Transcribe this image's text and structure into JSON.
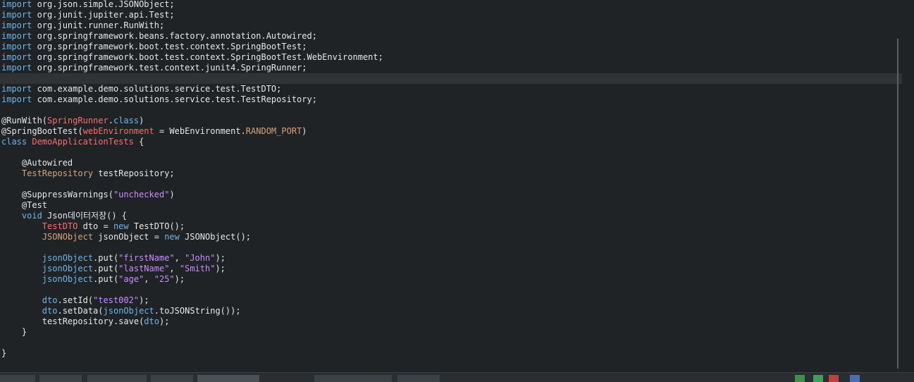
{
  "code": {
    "lines": [
      [
        {
          "t": "import",
          "c": "kw"
        },
        {
          "t": " org.json.simple.JSONObject;",
          "c": "id"
        }
      ],
      [
        {
          "t": "import",
          "c": "kw"
        },
        {
          "t": " org.junit.jupiter.api.Test;",
          "c": "id"
        }
      ],
      [
        {
          "t": "import",
          "c": "kw"
        },
        {
          "t": " org.junit.runner.RunWith;",
          "c": "id"
        }
      ],
      [
        {
          "t": "import",
          "c": "kw"
        },
        {
          "t": " org.springframework.beans.factory.annotation.Autowired;",
          "c": "id"
        }
      ],
      [
        {
          "t": "import",
          "c": "kw"
        },
        {
          "t": " org.springframework.boot.test.context.SpringBootTest;",
          "c": "id"
        }
      ],
      [
        {
          "t": "import",
          "c": "kw"
        },
        {
          "t": " org.springframework.boot.test.context.SpringBootTest.WebEnvironment;",
          "c": "id"
        }
      ],
      [
        {
          "t": "import",
          "c": "kw"
        },
        {
          "t": " org.springframework.test.context.junit4.SpringRunner;",
          "c": "id"
        }
      ],
      [],
      [
        {
          "t": "import",
          "c": "kw"
        },
        {
          "t": " com.example.demo.solutions.service.test.TestDTO;",
          "c": "id"
        }
      ],
      [
        {
          "t": "import",
          "c": "kw"
        },
        {
          "t": " com.example.demo.solutions.service.test.TestRepository;",
          "c": "id"
        }
      ],
      [],
      [
        {
          "t": "@RunWith(",
          "c": "an"
        },
        {
          "t": "SpringRunner",
          "c": "ty"
        },
        {
          "t": ".",
          "c": "id"
        },
        {
          "t": "class",
          "c": "kw"
        },
        {
          "t": ")",
          "c": "id"
        }
      ],
      [
        {
          "t": "@SpringBootTest(",
          "c": "an"
        },
        {
          "t": "webEnvironment",
          "c": "ty"
        },
        {
          "t": " = WebEnvironment.",
          "c": "id"
        },
        {
          "t": "RANDOM_PORT",
          "c": "fld"
        },
        {
          "t": ")",
          "c": "id"
        }
      ],
      [
        {
          "t": "class",
          "c": "kw"
        },
        {
          "t": " ",
          "c": "id"
        },
        {
          "t": "DemoApplicationTests",
          "c": "ty"
        },
        {
          "t": " {",
          "c": "id"
        }
      ],
      [],
      [
        {
          "t": "    @Autowired",
          "c": "an"
        }
      ],
      [
        {
          "t": "    ",
          "c": "id"
        },
        {
          "t": "TestRepository",
          "c": "fld"
        },
        {
          "t": " testRepository;",
          "c": "id"
        }
      ],
      [],
      [
        {
          "t": "    @SuppressWarnings(",
          "c": "an"
        },
        {
          "t": "\"unchecked\"",
          "c": "st"
        },
        {
          "t": ")",
          "c": "id"
        }
      ],
      [
        {
          "t": "    @Test",
          "c": "an"
        }
      ],
      [
        {
          "t": "    ",
          "c": "id"
        },
        {
          "t": "void",
          "c": "kw"
        },
        {
          "t": " Json데이터저장() {",
          "c": "id"
        }
      ],
      [
        {
          "t": "        ",
          "c": "id"
        },
        {
          "t": "TestDTO",
          "c": "ty"
        },
        {
          "t": " dto = ",
          "c": "id"
        },
        {
          "t": "new",
          "c": "kw"
        },
        {
          "t": " TestDTO();",
          "c": "id"
        }
      ],
      [
        {
          "t": "        ",
          "c": "id"
        },
        {
          "t": "JSONObject",
          "c": "fld"
        },
        {
          "t": " jsonObject = ",
          "c": "id"
        },
        {
          "t": "new",
          "c": "kw"
        },
        {
          "t": " JSONObject();",
          "c": "id"
        }
      ],
      [],
      [
        {
          "t": "        ",
          "c": "id"
        },
        {
          "t": "jsonObject",
          "c": "lv"
        },
        {
          "t": ".put(",
          "c": "id"
        },
        {
          "t": "\"firstName\"",
          "c": "st"
        },
        {
          "t": ", ",
          "c": "id"
        },
        {
          "t": "\"John\"",
          "c": "st"
        },
        {
          "t": ");",
          "c": "id"
        }
      ],
      [
        {
          "t": "        ",
          "c": "id"
        },
        {
          "t": "jsonObject",
          "c": "lv"
        },
        {
          "t": ".put(",
          "c": "id"
        },
        {
          "t": "\"lastName\"",
          "c": "st"
        },
        {
          "t": ", ",
          "c": "id"
        },
        {
          "t": "\"Smith\"",
          "c": "st"
        },
        {
          "t": ");",
          "c": "id"
        }
      ],
      [
        {
          "t": "        ",
          "c": "id"
        },
        {
          "t": "jsonObject",
          "c": "lv"
        },
        {
          "t": ".put(",
          "c": "id"
        },
        {
          "t": "\"age\"",
          "c": "st"
        },
        {
          "t": ", ",
          "c": "id"
        },
        {
          "t": "\"25\"",
          "c": "st"
        },
        {
          "t": ");",
          "c": "id"
        }
      ],
      [],
      [
        {
          "t": "        ",
          "c": "id"
        },
        {
          "t": "dto",
          "c": "lv"
        },
        {
          "t": ".setId(",
          "c": "id"
        },
        {
          "t": "\"test002\"",
          "c": "st"
        },
        {
          "t": ");",
          "c": "id"
        }
      ],
      [
        {
          "t": "        ",
          "c": "id"
        },
        {
          "t": "dto",
          "c": "lv"
        },
        {
          "t": ".setData(",
          "c": "id"
        },
        {
          "t": "jsonObject",
          "c": "lv"
        },
        {
          "t": ".toJSONString());",
          "c": "id"
        }
      ],
      [
        {
          "t": "        testRepository.save(",
          "c": "id"
        },
        {
          "t": "dto",
          "c": "lv"
        },
        {
          "t": ");",
          "c": "id"
        }
      ],
      [
        {
          "t": "    }",
          "c": "id"
        }
      ],
      [],
      [
        {
          "t": "}",
          "c": "id"
        }
      ]
    ],
    "highlighted_line": 7
  },
  "colors": {
    "background": "#1f2326",
    "keyword": "#6fb3e8",
    "type": "#ff6b6b",
    "string": "#c98bff",
    "field": "#d4a37a"
  }
}
